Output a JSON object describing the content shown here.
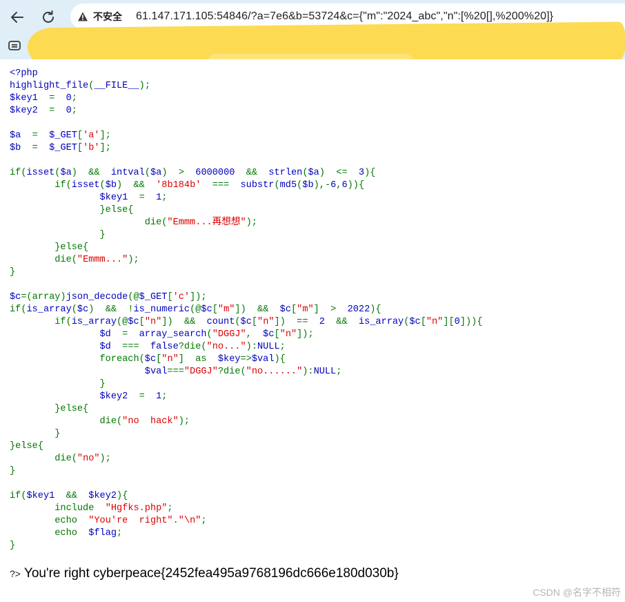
{
  "browser": {
    "back_icon": "arrow-left-icon",
    "reload_icon": "reload-icon",
    "security_label": "不安全",
    "url": "61.147.171.105:54846/?a=7e6&b=53724&c={\"m\":\"2024_abc\",\"n\":[%20[],%200%20]}",
    "tab_icon": "tab-search-icon"
  },
  "code_lines": [
    [
      [
        "p",
        "<?php"
      ]
    ],
    [
      [
        "p",
        "highlight_file"
      ],
      [
        "k",
        "("
      ],
      [
        "p",
        "__FILE__"
      ],
      [
        "k",
        ");"
      ]
    ],
    [
      [
        "p",
        "$key1  "
      ],
      [
        "k",
        "=  "
      ],
      [
        "p",
        "0"
      ],
      [
        "k",
        ";"
      ]
    ],
    [
      [
        "p",
        "$key2  "
      ],
      [
        "k",
        "=  "
      ],
      [
        "p",
        "0"
      ],
      [
        "k",
        ";"
      ]
    ],
    [],
    [
      [
        "p",
        "$a  "
      ],
      [
        "k",
        "=  "
      ],
      [
        "p",
        "$_GET"
      ],
      [
        "k",
        "["
      ],
      [
        "s",
        "'a'"
      ],
      [
        "k",
        "];"
      ]
    ],
    [
      [
        "p",
        "$b  "
      ],
      [
        "k",
        "=  "
      ],
      [
        "p",
        "$_GET"
      ],
      [
        "k",
        "["
      ],
      [
        "s",
        "'b'"
      ],
      [
        "k",
        "];"
      ]
    ],
    [],
    [
      [
        "k",
        "if("
      ],
      [
        "p",
        "isset"
      ],
      [
        "k",
        "("
      ],
      [
        "p",
        "$a"
      ],
      [
        "k",
        ")  &&  "
      ],
      [
        "p",
        "intval"
      ],
      [
        "k",
        "("
      ],
      [
        "p",
        "$a"
      ],
      [
        "k",
        ")  >  "
      ],
      [
        "p",
        "6000000  "
      ],
      [
        "k",
        "&&  "
      ],
      [
        "p",
        "strlen"
      ],
      [
        "k",
        "("
      ],
      [
        "p",
        "$a"
      ],
      [
        "k",
        ")  <=  "
      ],
      [
        "p",
        "3"
      ],
      [
        "k",
        "){"
      ]
    ],
    [
      [
        "k",
        "        if("
      ],
      [
        "p",
        "isset"
      ],
      [
        "k",
        "("
      ],
      [
        "p",
        "$b"
      ],
      [
        "k",
        ")  &&  "
      ],
      [
        "s",
        "'8b184b'  "
      ],
      [
        "k",
        "===  "
      ],
      [
        "p",
        "substr"
      ],
      [
        "k",
        "("
      ],
      [
        "p",
        "md5"
      ],
      [
        "k",
        "("
      ],
      [
        "p",
        "$b"
      ],
      [
        "k",
        "),-"
      ],
      [
        "p",
        "6"
      ],
      [
        "k",
        ","
      ],
      [
        "p",
        "6"
      ],
      [
        "k",
        ")){"
      ]
    ],
    [
      [
        "p",
        "                $key1  "
      ],
      [
        "k",
        "=  "
      ],
      [
        "p",
        "1"
      ],
      [
        "k",
        ";"
      ]
    ],
    [
      [
        "k",
        "                }else{"
      ]
    ],
    [
      [
        "k",
        "                        die("
      ],
      [
        "s",
        "\"Emmm...再想想\""
      ],
      [
        "k",
        ");"
      ]
    ],
    [
      [
        "k",
        "                }"
      ]
    ],
    [
      [
        "k",
        "        }else{"
      ]
    ],
    [
      [
        "k",
        "        die("
      ],
      [
        "s",
        "\"Emmm...\""
      ],
      [
        "k",
        ");"
      ]
    ],
    [
      [
        "k",
        "}"
      ]
    ],
    [],
    [
      [
        "p",
        "$c"
      ],
      [
        "k",
        "=(array)"
      ],
      [
        "p",
        "json_decode"
      ],
      [
        "k",
        "(@"
      ],
      [
        "p",
        "$_GET"
      ],
      [
        "k",
        "["
      ],
      [
        "s",
        "'c'"
      ],
      [
        "k",
        "]);"
      ]
    ],
    [
      [
        "k",
        "if("
      ],
      [
        "p",
        "is_array"
      ],
      [
        "k",
        "("
      ],
      [
        "p",
        "$c"
      ],
      [
        "k",
        ")  &&  !"
      ],
      [
        "p",
        "is_numeric"
      ],
      [
        "k",
        "(@"
      ],
      [
        "p",
        "$c"
      ],
      [
        "k",
        "["
      ],
      [
        "s",
        "\"m\""
      ],
      [
        "k",
        "])  &&  "
      ],
      [
        "p",
        "$c"
      ],
      [
        "k",
        "["
      ],
      [
        "s",
        "\"m\""
      ],
      [
        "k",
        "]  >  "
      ],
      [
        "p",
        "2022"
      ],
      [
        "k",
        "){"
      ]
    ],
    [
      [
        "k",
        "        if("
      ],
      [
        "p",
        "is_array"
      ],
      [
        "k",
        "(@"
      ],
      [
        "p",
        "$c"
      ],
      [
        "k",
        "["
      ],
      [
        "s",
        "\"n\""
      ],
      [
        "k",
        "])  &&  "
      ],
      [
        "p",
        "count"
      ],
      [
        "k",
        "("
      ],
      [
        "p",
        "$c"
      ],
      [
        "k",
        "["
      ],
      [
        "s",
        "\"n\""
      ],
      [
        "k",
        "])  ==  "
      ],
      [
        "p",
        "2  "
      ],
      [
        "k",
        "&&  "
      ],
      [
        "p",
        "is_array"
      ],
      [
        "k",
        "("
      ],
      [
        "p",
        "$c"
      ],
      [
        "k",
        "["
      ],
      [
        "s",
        "\"n\""
      ],
      [
        "k",
        "]["
      ],
      [
        "p",
        "0"
      ],
      [
        "k",
        "])){"
      ]
    ],
    [
      [
        "p",
        "                $d  "
      ],
      [
        "k",
        "=  "
      ],
      [
        "p",
        "array_search"
      ],
      [
        "k",
        "("
      ],
      [
        "s",
        "\"DGGJ\""
      ],
      [
        "k",
        ",  "
      ],
      [
        "p",
        "$c"
      ],
      [
        "k",
        "["
      ],
      [
        "s",
        "\"n\""
      ],
      [
        "k",
        "]);"
      ]
    ],
    [
      [
        "p",
        "                $d  "
      ],
      [
        "k",
        "===  "
      ],
      [
        "p",
        "false"
      ],
      [
        "k",
        "?die("
      ],
      [
        "s",
        "\"no...\""
      ],
      [
        "k",
        "):"
      ],
      [
        "p",
        "NULL"
      ],
      [
        "k",
        ";"
      ]
    ],
    [
      [
        "k",
        "                foreach("
      ],
      [
        "p",
        "$c"
      ],
      [
        "k",
        "["
      ],
      [
        "s",
        "\"n\""
      ],
      [
        "k",
        "]  as  "
      ],
      [
        "p",
        "$key"
      ],
      [
        "k",
        "=>"
      ],
      [
        "p",
        "$val"
      ],
      [
        "k",
        "){"
      ]
    ],
    [
      [
        "p",
        "                        $val"
      ],
      [
        "k",
        "==="
      ],
      [
        "s",
        "\"DGGJ\""
      ],
      [
        "k",
        "?die("
      ],
      [
        "s",
        "\"no......\""
      ],
      [
        "k",
        "):"
      ],
      [
        "p",
        "NULL"
      ],
      [
        "k",
        ";"
      ]
    ],
    [
      [
        "k",
        "                }"
      ]
    ],
    [
      [
        "p",
        "                $key2  "
      ],
      [
        "k",
        "=  "
      ],
      [
        "p",
        "1"
      ],
      [
        "k",
        ";"
      ]
    ],
    [
      [
        "k",
        "        }else{"
      ]
    ],
    [
      [
        "k",
        "                die("
      ],
      [
        "s",
        "\"no  hack\""
      ],
      [
        "k",
        ");"
      ]
    ],
    [
      [
        "k",
        "        }"
      ]
    ],
    [
      [
        "k",
        "}else{"
      ]
    ],
    [
      [
        "k",
        "        die("
      ],
      [
        "s",
        "\"no\""
      ],
      [
        "k",
        ");"
      ]
    ],
    [
      [
        "k",
        "}"
      ]
    ],
    [],
    [
      [
        "k",
        "if("
      ],
      [
        "p",
        "$key1  "
      ],
      [
        "k",
        "&&  "
      ],
      [
        "p",
        "$key2"
      ],
      [
        "k",
        "){"
      ]
    ],
    [
      [
        "k",
        "        include  "
      ],
      [
        "s",
        "\"Hgfks.php\""
      ],
      [
        "k",
        ";"
      ]
    ],
    [
      [
        "k",
        "        echo  "
      ],
      [
        "s",
        "\"You're  right\""
      ],
      [
        "k",
        "."
      ],
      [
        "s",
        "\"\\n\""
      ],
      [
        "k",
        ";"
      ]
    ],
    [
      [
        "k",
        "        echo  "
      ],
      [
        "p",
        "$flag"
      ],
      [
        "k",
        ";"
      ]
    ],
    [
      [
        "k",
        "}"
      ]
    ]
  ],
  "output": {
    "tag": "?>",
    "text": "You're right cyberpeace{2452fea495a9768196dc666e180d030b}"
  },
  "watermark": "CSDN @名字不相符",
  "colors": {
    "chrome_bg": "#dfeef7",
    "php_default": "#0000bb",
    "php_keyword": "#007700",
    "php_string": "#dd0000",
    "redaction": "#fdd94a"
  }
}
